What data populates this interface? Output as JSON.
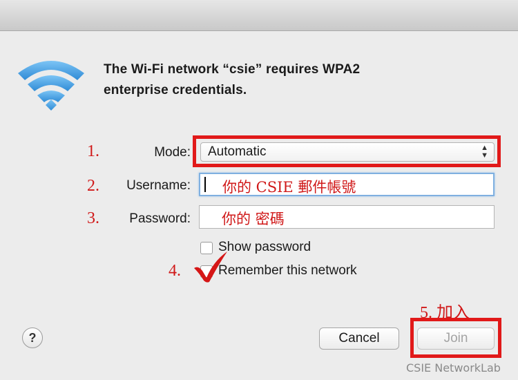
{
  "dialog": {
    "message_line1": "The Wi-Fi network “csie” requires WPA2",
    "message_line2": "enterprise credentials."
  },
  "steps": {
    "step1": "1.",
    "step2": "2.",
    "step3": "3.",
    "step4": "4.",
    "step5": "5. 加入"
  },
  "form": {
    "mode_label": "Mode:",
    "mode_value": "Automatic",
    "username_label": "Username:",
    "username_hint": "你的 CSIE 郵件帳號",
    "password_label": "Password:",
    "password_hint": "你的 密碼",
    "show_password_label": "Show password",
    "show_password_checked": false,
    "remember_label": "Remember this network",
    "remember_checked": true
  },
  "buttons": {
    "help": "?",
    "cancel": "Cancel",
    "join": "Join"
  },
  "watermark": "CSIE NetworkLab",
  "colors": {
    "annotation_red": "#e11919",
    "focus_blue": "#7fb0e0",
    "wifi_blue": "#4aa3e6"
  },
  "icons": {
    "wifi": "wifi-icon",
    "help": "question-icon",
    "select_arrows": "up-down-arrows-icon",
    "checkmark": "checkmark-icon"
  }
}
